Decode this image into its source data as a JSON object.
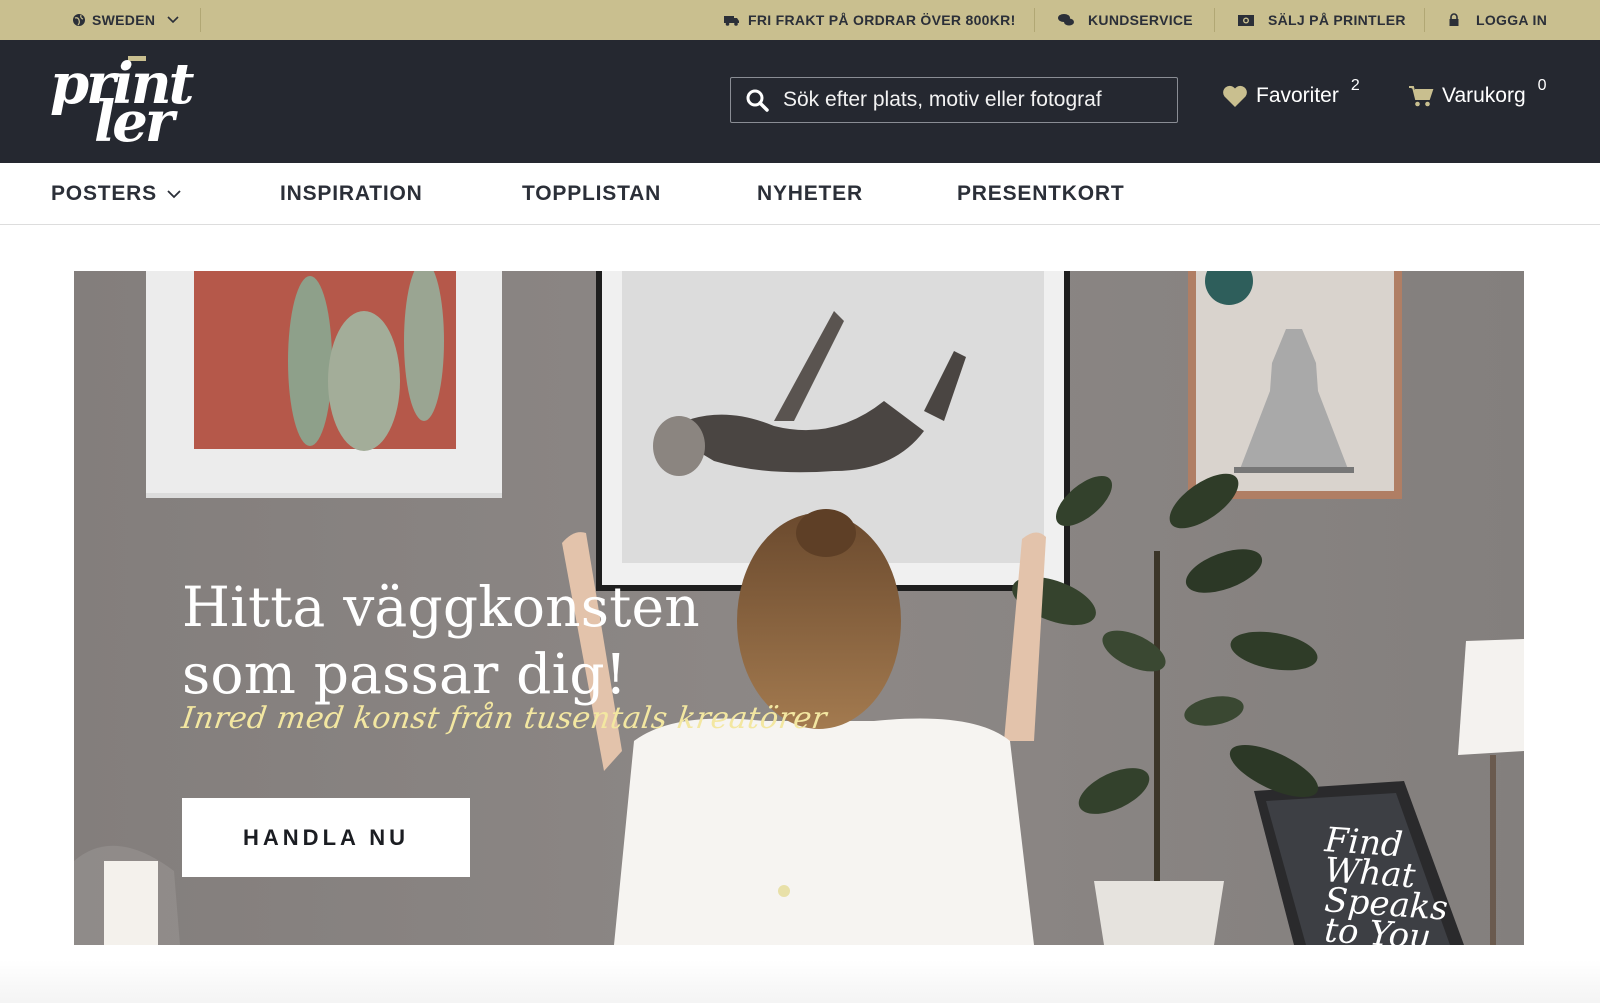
{
  "topbar": {
    "country": "SWEDEN",
    "shipping": "FRI FRAKT PÅ ORDRAR ÖVER 800KR!",
    "customer_service": "KUNDSERVICE",
    "sell": "SÄLJ PÅ PRINTLER",
    "login": "LOGGA IN"
  },
  "header": {
    "logo_line1": "print",
    "logo_line2": "ler",
    "search_placeholder": "Sök efter plats, motiv eller fotograf",
    "favorites_label": "Favoriter",
    "favorites_count": "2",
    "cart_label": "Varukorg",
    "cart_count": "0"
  },
  "nav": {
    "items": [
      {
        "label": "POSTERS",
        "has_dropdown": true
      },
      {
        "label": "INSPIRATION"
      },
      {
        "label": "TOPPLISTAN"
      },
      {
        "label": "NYHETER"
      },
      {
        "label": "PRESENTKORT"
      }
    ]
  },
  "hero": {
    "title_line1": "Hitta väggkonsten",
    "title_line2": "som passar dig!",
    "subtitle": "Inred med konst från tusentals kreatörer",
    "cta": "HANDLA NU",
    "poster_text": "Find What Speaks to You"
  },
  "colors": {
    "topbar": "#c9bf8f",
    "header": "#252830",
    "accent": "#c9bf8f",
    "hero_subtitle": "#f3e7a1"
  }
}
